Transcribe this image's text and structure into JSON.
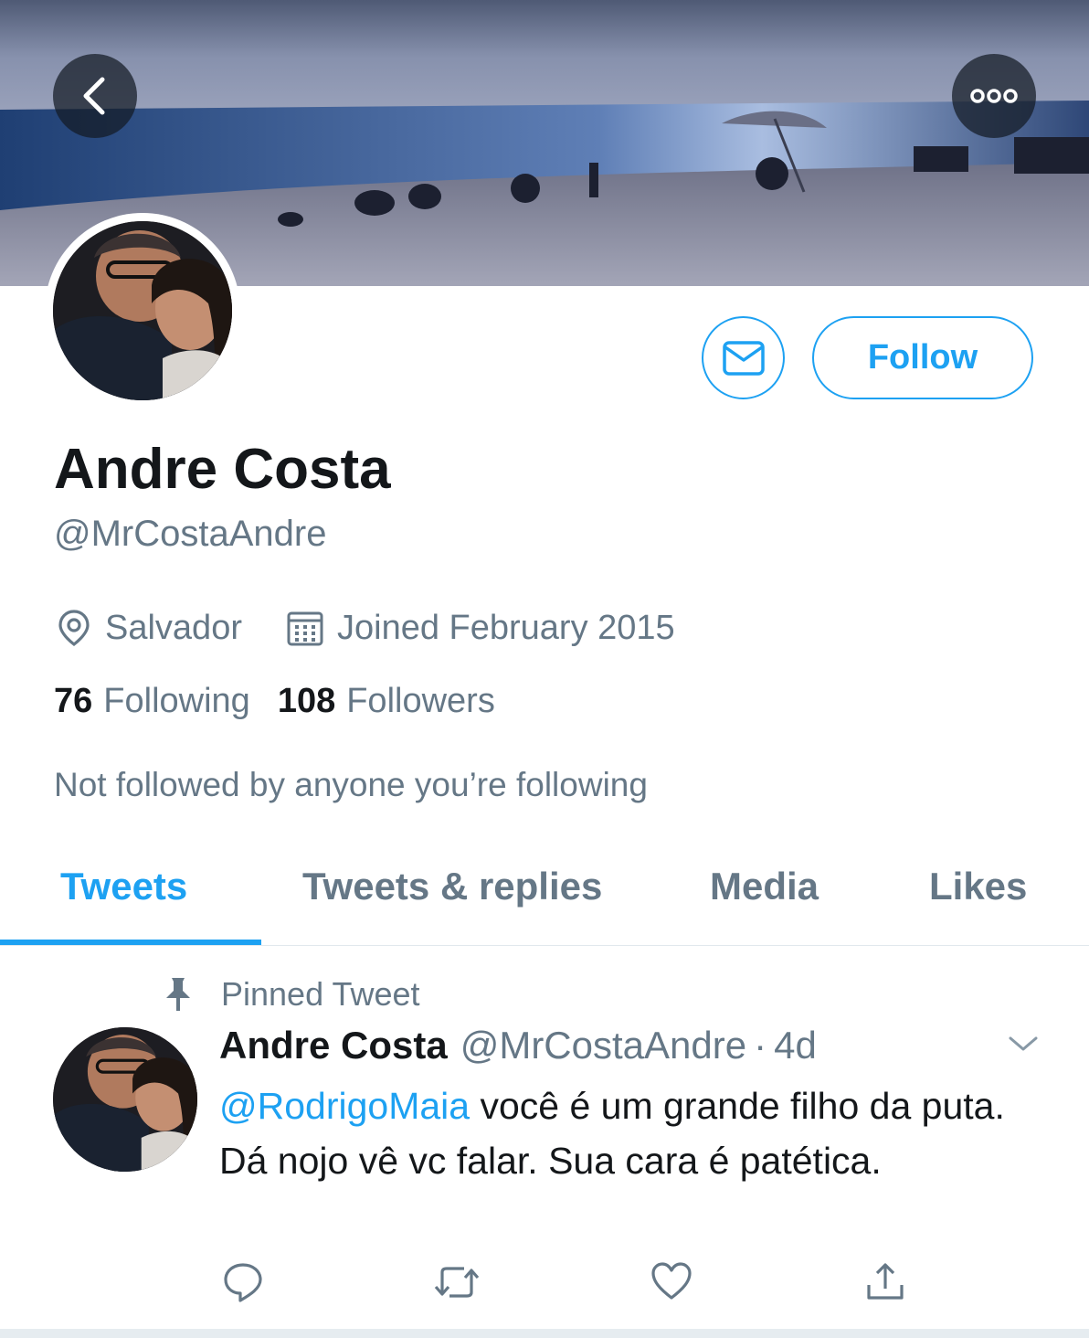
{
  "header": {
    "back_icon": "chevron-left-icon",
    "more_icon": "more-horizontal-icon"
  },
  "profile": {
    "name": "Andre Costa",
    "handle": "@MrCostaAndre",
    "location": "Salvador",
    "joined": "Joined February 2015",
    "following_count": "76",
    "following_label": "Following",
    "followers_count": "108",
    "followers_label": "Followers",
    "not_followed": "Not followed by anyone you’re following"
  },
  "actions": {
    "follow_label": "Follow",
    "message_icon": "envelope-icon"
  },
  "tabs": [
    {
      "label": "Tweets",
      "active": true
    },
    {
      "label": "Tweets & replies",
      "active": false
    },
    {
      "label": "Media",
      "active": false
    },
    {
      "label": "Likes",
      "active": false
    }
  ],
  "tweet": {
    "pinned_label": "Pinned Tweet",
    "author_name": "Andre Costa",
    "author_handle": "@MrCostaAndre",
    "separator": "·",
    "time": "4d",
    "mention": "@RodrigoMaia",
    "text": " você é um grande filho da puta. Dá nojo vê vc falar. Sua cara é patética."
  },
  "colors": {
    "accent": "#1da1f2",
    "secondary_text": "#657786",
    "primary_text": "#14171a"
  }
}
